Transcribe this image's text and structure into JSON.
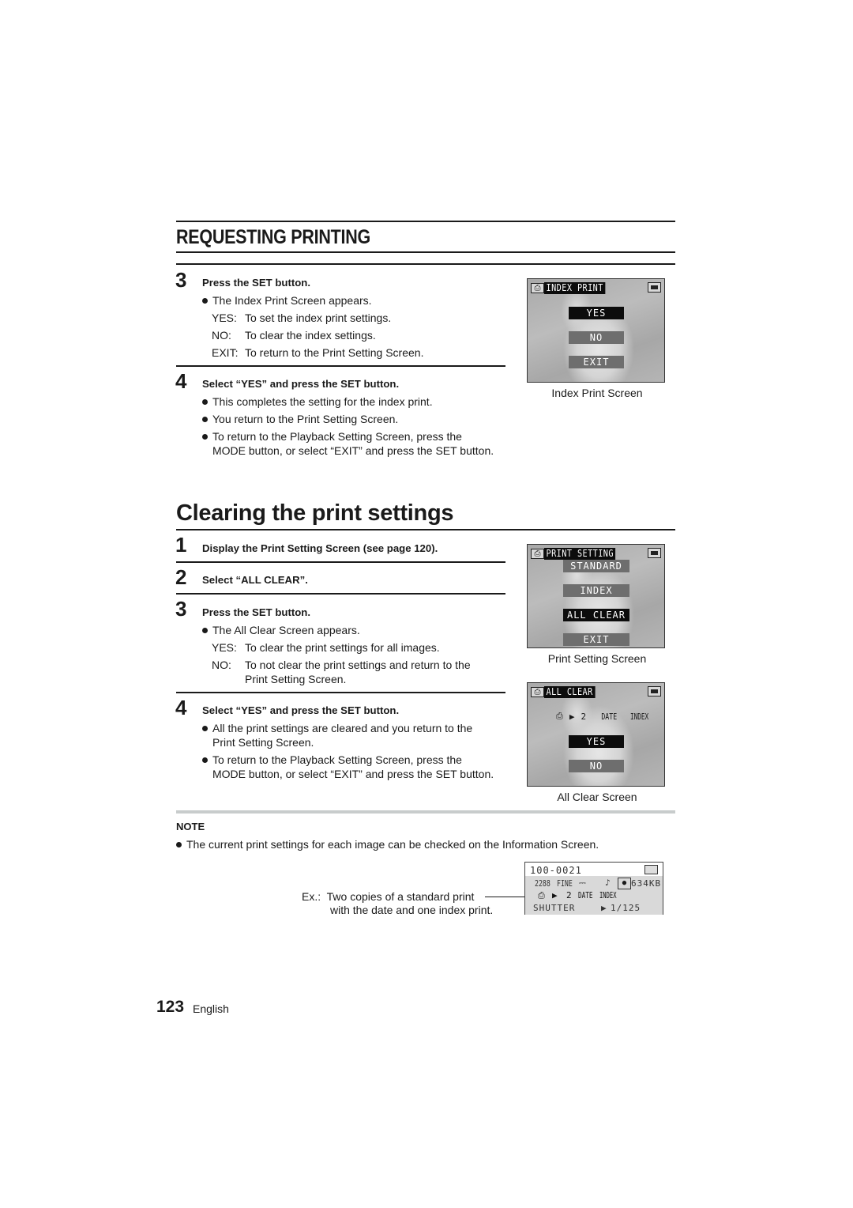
{
  "section_title": "REQUESTING PRINTING",
  "part1": {
    "step3": {
      "number": "3",
      "title": "Press the SET button.",
      "bullet": "The Index Print Screen appears.",
      "options": [
        {
          "label": "YES:",
          "text": "To set the index print settings."
        },
        {
          "label": "NO:",
          "text": "To clear the index settings."
        },
        {
          "label": "EXIT:",
          "text": "To return to the Print Setting Screen."
        }
      ]
    },
    "step4": {
      "number": "4",
      "title": "Select “YES” and press the SET button.",
      "bullets": [
        "This completes the setting for the index print.",
        "You return to the Print Setting Screen.",
        "To return to the Playback Setting Screen, press the",
        "MODE button, or select “EXIT” and press the SET button."
      ]
    },
    "screen": {
      "icon": "printer-icon",
      "title": "INDEX PRINT",
      "options": [
        "YES",
        "NO",
        "EXIT"
      ],
      "selected": "YES",
      "caption": "Index Print Screen"
    }
  },
  "clearing": {
    "heading": "Clearing the print settings",
    "step1": {
      "number": "1",
      "title": "Display the Print Setting Screen (see page 120)."
    },
    "step2": {
      "number": "2",
      "title": "Select “ALL CLEAR”."
    },
    "step3": {
      "number": "3",
      "title": "Press the SET button.",
      "bullet": "The All Clear Screen appears.",
      "yes_label": "YES:",
      "yes_text": "To clear the print settings for all images.",
      "no_label": "NO:",
      "no_text_1": "To not clear the print settings and return to the",
      "no_text_2": "Print Setting Screen."
    },
    "step4": {
      "number": "4",
      "title": "Select “YES” and press the SET button.",
      "bullet1_a": "All the print settings are cleared and you return to the",
      "bullet1_b": "Print Setting Screen.",
      "bullet2_a": "To return to the Playback Setting Screen, press the",
      "bullet2_b": "MODE button, or select “EXIT” and press the SET button."
    },
    "print_setting_screen": {
      "title": "PRINT SETTING",
      "options": [
        "STANDARD",
        "INDEX",
        "ALL CLEAR",
        "EXIT"
      ],
      "selected": "ALL CLEAR",
      "caption": "Print Setting Screen"
    },
    "all_clear_screen": {
      "title": "ALL CLEAR",
      "status_count": "2",
      "status_date": "DATE",
      "status_index": "INDEX",
      "options": [
        "YES",
        "NO"
      ],
      "selected": "YES",
      "caption": "All Clear Screen"
    }
  },
  "note": {
    "label": "NOTE",
    "text": "The current print settings for each image can be checked on the Information Screen.",
    "example_line1": "Ex.:  Two copies of a standard print",
    "example_line2": "with the date and one index print.",
    "info_screen": {
      "file_number": "100-0021",
      "resolution": "2288",
      "quality": "FINE",
      "file_size": "634KB",
      "print_count": "2",
      "print_date": "DATE",
      "print_index": "INDEX",
      "shutter_label": "SHUTTER",
      "shutter_value": "1/125"
    }
  },
  "footer": {
    "page_number": "123",
    "language": "English"
  }
}
